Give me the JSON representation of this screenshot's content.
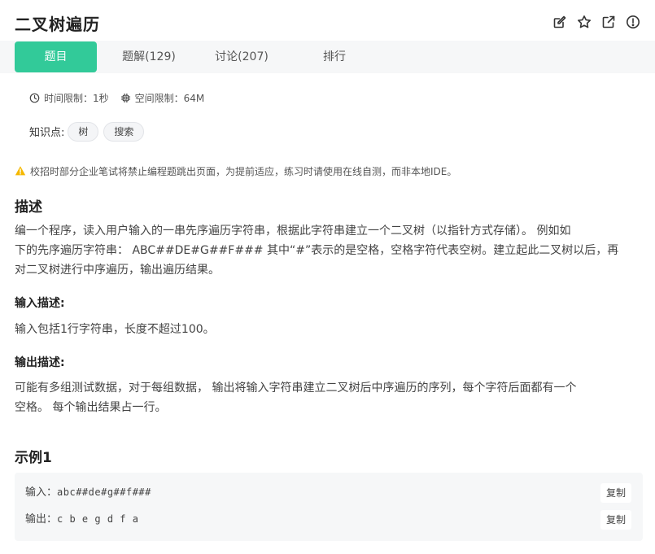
{
  "problem": {
    "title": "二叉树遍历"
  },
  "header_icons": [
    "edit-icon",
    "star-icon",
    "share-icon",
    "info-icon"
  ],
  "tabs": [
    {
      "label": "题目",
      "active": true
    },
    {
      "label": "题解(129)",
      "active": false
    },
    {
      "label": "讨论(207)",
      "active": false
    },
    {
      "label": "排行",
      "active": false
    }
  ],
  "limits": {
    "time": "时间限制：1秒",
    "space": "空间限制：64M"
  },
  "knowledge": {
    "label": "知识点:",
    "tags": [
      "树",
      "搜索"
    ]
  },
  "warning": "校招时部分企业笔试将禁止编程题跳出页面，为提前适应，练习时请使用在线自测，而非本地IDE。",
  "description": {
    "heading": "描述",
    "lines": [
      "编一个程序，读入用户输入的一串先序遍历字符串，根据此字符串建立一个二叉树（以指针方式存储）。 例如如",
      "下的先序遍历字符串： ABC##DE#G##F### 其中“#”表示的是空格，空格字符代表空树。建立起此二叉树以后，再",
      "对二叉树进行中序遍历，输出遍历结果。"
    ]
  },
  "input_desc": {
    "heading": "输入描述:",
    "text": "输入包括1行字符串，长度不超过100。"
  },
  "output_desc": {
    "heading": "输出描述:",
    "lines": [
      "可能有多组测试数据，对于每组数据， 输出将输入字符串建立二叉树后中序遍历的序列，每个字符后面都有一个",
      "空格。 每个输出结果占一行。"
    ]
  },
  "example": {
    "heading": "示例1",
    "input_label": "输入：",
    "input_value": "abc##de#g##f###",
    "output_label": "输出：",
    "output_value": "c b e g d f a",
    "copy_label": "复制"
  },
  "colors": {
    "accent": "#32ca99",
    "warning": "#f5b800",
    "tab_bar_bg": "#f6f7f8"
  }
}
